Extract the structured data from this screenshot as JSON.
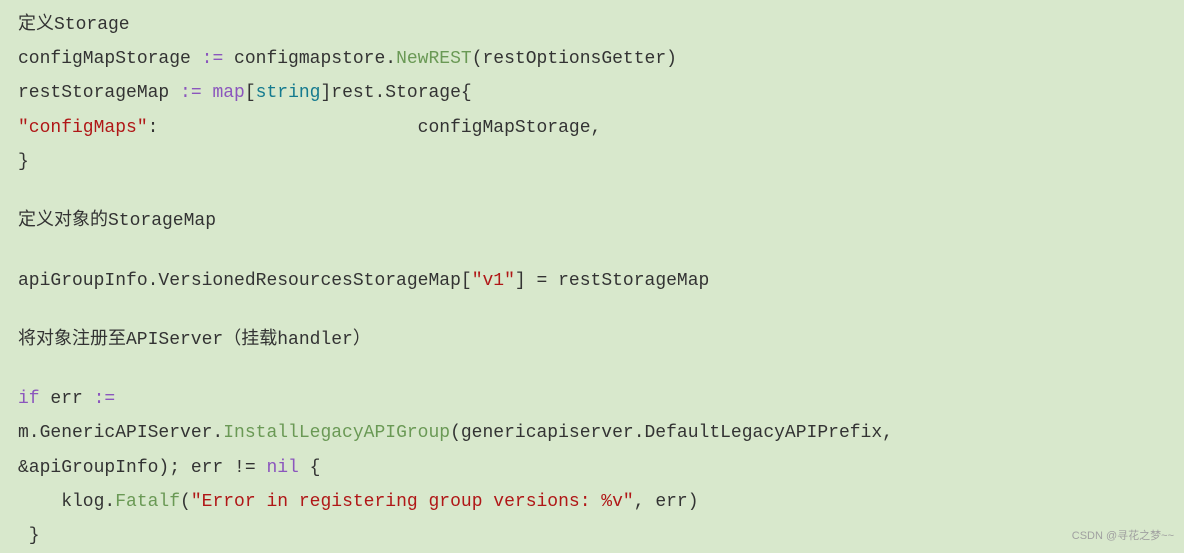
{
  "comment1": "定义Storage",
  "line1": {
    "p1": "configMapStorage ",
    "assign": ":=",
    "p2": " configmapstore.",
    "func": "NewREST",
    "p3": "(restOptionsGetter)"
  },
  "line2": {
    "p1": "restStorageMap ",
    "assign": ":=",
    "p2": " ",
    "map": "map",
    "p3": "[",
    "str": "string",
    "p4": "]rest.Storage{"
  },
  "line3": {
    "key": "\"configMaps\"",
    "p1": ":                        configMapStorage,"
  },
  "line4": "}",
  "comment2": "定义对象的StorageMap",
  "line5": {
    "p1": "apiGroupInfo.VersionedResourcesStorageMap[",
    "key": "\"v1\"",
    "p2": "] = restStorageMap"
  },
  "comment3": "将对象注册至APIServer（挂载handler）",
  "line6": {
    "if": "if",
    "p1": " err ",
    "assign": ":="
  },
  "line7": {
    "p1": "m.GenericAPIServer.",
    "func": "InstallLegacyAPIGroup",
    "p2": "(genericapiserver.DefaultLegacyAPIPrefix,"
  },
  "line8": {
    "p1": "&apiGroupInfo); err != ",
    "nil": "nil",
    "p2": " {"
  },
  "line9": {
    "p1": "    klog.",
    "func": "Fatalf",
    "p2": "(",
    "str": "\"Error in registering group versions: %v\"",
    "p3": ", err)"
  },
  "line10": " }",
  "watermark": "CSDN @寻花之梦~~"
}
